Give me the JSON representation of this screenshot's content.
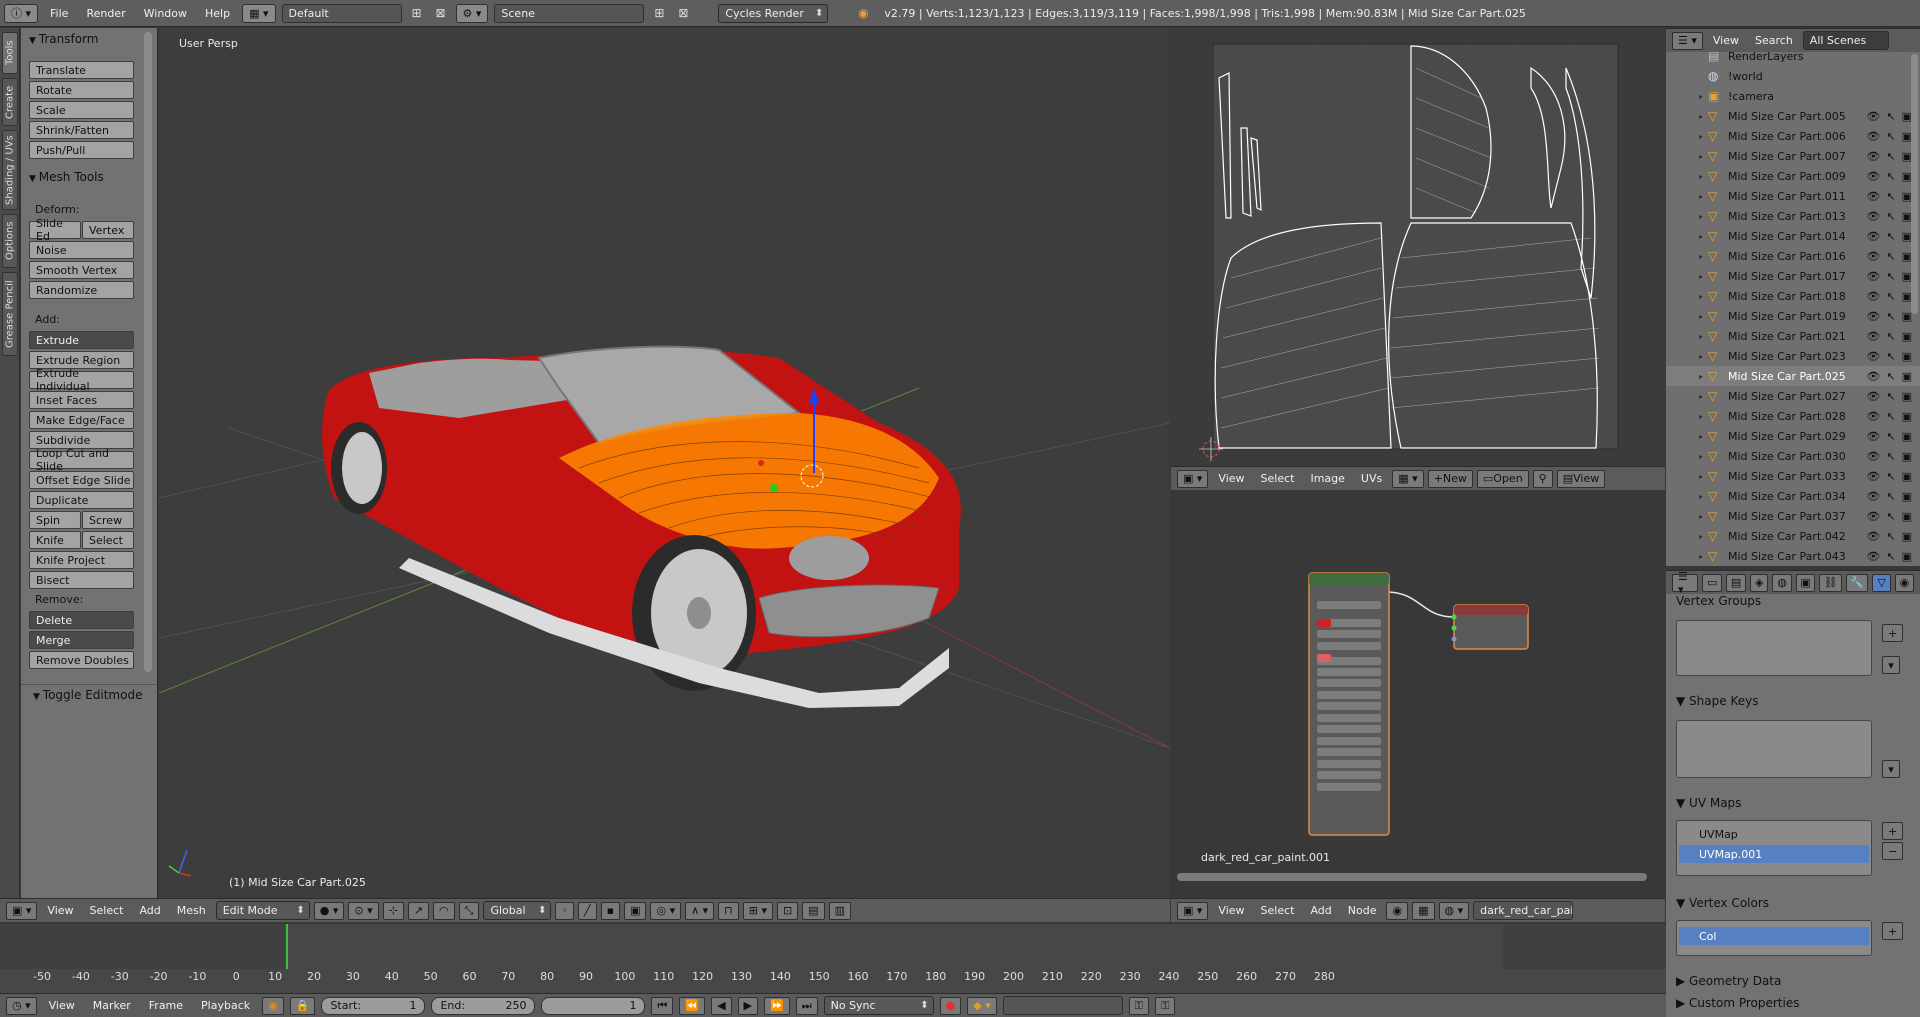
{
  "topbar": {
    "menus": [
      "File",
      "Render",
      "Window",
      "Help"
    ],
    "layout": "Default",
    "scene": "Scene",
    "engine": "Cycles Render",
    "stats": "v2.79 | Verts:1,123/1,123 | Edges:3,119/3,119 | Faces:1,998/1,998 | Tris:1,998 | Mem:90.83M | Mid Size Car Part.025"
  },
  "tabs": [
    "Tools",
    "Create",
    "Shading / UVs",
    "Options",
    "Grease Pencil"
  ],
  "toolshelf": {
    "transform_title": "Transform",
    "transform": [
      "Translate",
      "Rotate",
      "Scale",
      "Shrink/Fatten",
      "Push/Pull"
    ],
    "mesh_tools_title": "Mesh Tools",
    "deform_label": "Deform:",
    "deform_row": [
      "Slide Ed",
      "Vertex"
    ],
    "deform": [
      "Noise",
      "Smooth Vertex",
      "Randomize"
    ],
    "add_label": "Add:",
    "extrude": "Extrude",
    "add": [
      "Extrude Region",
      "Extrude Individual",
      "Inset Faces",
      "Make Edge/Face",
      "Subdivide",
      "Loop Cut and Slide",
      "Offset Edge Slide",
      "Duplicate"
    ],
    "spin_row": [
      "Spin",
      "Screw"
    ],
    "knife_row": [
      "Knife",
      "Select"
    ],
    "add2": [
      "Knife Project",
      "Bisect"
    ],
    "remove_label": "Remove:",
    "delete": "Delete",
    "merge": "Merge",
    "remove_doubles": "Remove Doubles",
    "toggle_editmode": "Toggle Editmode"
  },
  "viewport": {
    "view_label": "User Persp",
    "object_label": "(1) Mid Size Car Part.025",
    "header_menus": [
      "View",
      "Select",
      "Add",
      "Mesh"
    ],
    "mode": "Edit Mode",
    "orientation": "Global"
  },
  "uv_editor": {
    "menus": [
      "View",
      "Select",
      "Image",
      "UVs"
    ],
    "new": "New",
    "open": "Open",
    "view": "View"
  },
  "node_editor": {
    "material_name": "dark_red_car_paint.001",
    "menus": [
      "View",
      "Select",
      "Add",
      "Node"
    ],
    "field": "dark_red_car_paint."
  },
  "outliner": {
    "menus": [
      "View",
      "Search"
    ],
    "scenes": "All Scenes",
    "top_items": [
      "RenderLayers",
      "!world",
      "!camera"
    ],
    "items": [
      "Mid Size Car Part.005",
      "Mid Size Car Part.006",
      "Mid Size Car Part.007",
      "Mid Size Car Part.009",
      "Mid Size Car Part.011",
      "Mid Size Car Part.013",
      "Mid Size Car Part.014",
      "Mid Size Car Part.016",
      "Mid Size Car Part.017",
      "Mid Size Car Part.018",
      "Mid Size Car Part.019",
      "Mid Size Car Part.021",
      "Mid Size Car Part.023",
      "Mid Size Car Part.025",
      "Mid Size Car Part.027",
      "Mid Size Car Part.028",
      "Mid Size Car Part.029",
      "Mid Size Car Part.030",
      "Mid Size Car Part.033",
      "Mid Size Car Part.034",
      "Mid Size Car Part.037",
      "Mid Size Car Part.042",
      "Mid Size Car Part.043"
    ],
    "selected": "Mid Size Car Part.025"
  },
  "properties": {
    "vertex_groups": "Vertex Groups",
    "shape_keys": "Shape Keys",
    "uv_maps": "UV Maps",
    "uv_map_items": [
      "UVMap",
      "UVMap.001"
    ],
    "vertex_colors": "Vertex Colors",
    "vc_item": "Col",
    "geometry_data": "Geometry Data",
    "custom_properties": "Custom Properties"
  },
  "timeline": {
    "ticks": [
      "-50",
      "-40",
      "-30",
      "-20",
      "-10",
      "0",
      "10",
      "20",
      "30",
      "40",
      "50",
      "60",
      "70",
      "80",
      "90",
      "100",
      "110",
      "120",
      "130",
      "140",
      "150",
      "160",
      "170",
      "180",
      "190",
      "200",
      "210",
      "220",
      "230",
      "240",
      "250",
      "260",
      "270",
      "280"
    ],
    "menus": [
      "View",
      "Marker",
      "Frame",
      "Playback"
    ],
    "start_label": "Start:",
    "start": "1",
    "end_label": "End:",
    "end": "250",
    "current": "1",
    "sync": "No Sync"
  },
  "colors": {
    "car": "#c31212",
    "selection": "#ff8a00",
    "ui_bg": "#727272"
  }
}
